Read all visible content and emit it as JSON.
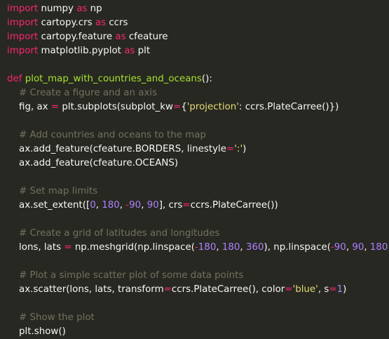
{
  "colors": {
    "background": "#272822",
    "keyword": "#f92672",
    "function_name": "#a6e22e",
    "string": "#e6db74",
    "number": "#ae81ff",
    "comment": "#75715e",
    "text": "#f8f8f2"
  },
  "lines": [
    {
      "tokens": [
        {
          "t": "import",
          "c": "kw"
        },
        {
          "t": " numpy ",
          "c": "tx"
        },
        {
          "t": "as",
          "c": "kw"
        },
        {
          "t": " np",
          "c": "tx"
        }
      ]
    },
    {
      "tokens": [
        {
          "t": "import",
          "c": "kw"
        },
        {
          "t": " cartopy.crs ",
          "c": "tx"
        },
        {
          "t": "as",
          "c": "kw"
        },
        {
          "t": " ccrs",
          "c": "tx"
        }
      ]
    },
    {
      "tokens": [
        {
          "t": "import",
          "c": "kw"
        },
        {
          "t": " cartopy.feature ",
          "c": "tx"
        },
        {
          "t": "as",
          "c": "kw"
        },
        {
          "t": " cfeature",
          "c": "tx"
        }
      ]
    },
    {
      "tokens": [
        {
          "t": "import",
          "c": "kw"
        },
        {
          "t": " matplotlib.pyplot ",
          "c": "tx"
        },
        {
          "t": "as",
          "c": "kw"
        },
        {
          "t": " plt",
          "c": "tx"
        }
      ]
    },
    {
      "tokens": []
    },
    {
      "tokens": [
        {
          "t": "def",
          "c": "kw"
        },
        {
          "t": " ",
          "c": "tx"
        },
        {
          "t": "plot_map_with_countries_and_oceans",
          "c": "fn"
        },
        {
          "t": "():",
          "c": "tx"
        }
      ]
    },
    {
      "tokens": [
        {
          "t": "    # Create a figure and an axis",
          "c": "cm"
        }
      ]
    },
    {
      "tokens": [
        {
          "t": "    fig, ax ",
          "c": "tx"
        },
        {
          "t": "=",
          "c": "kw"
        },
        {
          "t": " plt.subplots(subplot_kw",
          "c": "tx"
        },
        {
          "t": "=",
          "c": "kw"
        },
        {
          "t": "{",
          "c": "tx"
        },
        {
          "t": "'projection'",
          "c": "str"
        },
        {
          "t": ": ccrs.PlateCarree()})",
          "c": "tx"
        }
      ]
    },
    {
      "tokens": []
    },
    {
      "tokens": [
        {
          "t": "    # Add countries and oceans to the map",
          "c": "cm"
        }
      ]
    },
    {
      "tokens": [
        {
          "t": "    ax.add_feature(cfeature.BORDERS, linestyle",
          "c": "tx"
        },
        {
          "t": "=",
          "c": "kw"
        },
        {
          "t": "':'",
          "c": "str"
        },
        {
          "t": ")",
          "c": "tx"
        }
      ]
    },
    {
      "tokens": [
        {
          "t": "    ax.add_feature(cfeature.OCEANS)",
          "c": "tx"
        }
      ]
    },
    {
      "tokens": []
    },
    {
      "tokens": [
        {
          "t": "    # Set map limits",
          "c": "cm"
        }
      ]
    },
    {
      "tokens": [
        {
          "t": "    ax.set_extent([",
          "c": "tx"
        },
        {
          "t": "0",
          "c": "num"
        },
        {
          "t": ", ",
          "c": "tx"
        },
        {
          "t": "180",
          "c": "num"
        },
        {
          "t": ", ",
          "c": "tx"
        },
        {
          "t": "-",
          "c": "kw"
        },
        {
          "t": "90",
          "c": "num"
        },
        {
          "t": ", ",
          "c": "tx"
        },
        {
          "t": "90",
          "c": "num"
        },
        {
          "t": "], crs",
          "c": "tx"
        },
        {
          "t": "=",
          "c": "kw"
        },
        {
          "t": "ccrs.PlateCarree())",
          "c": "tx"
        }
      ]
    },
    {
      "tokens": []
    },
    {
      "tokens": [
        {
          "t": "    # Create a grid of latitudes and longitudes",
          "c": "cm"
        }
      ]
    },
    {
      "tokens": [
        {
          "t": "    lons, lats ",
          "c": "tx"
        },
        {
          "t": "=",
          "c": "kw"
        },
        {
          "t": " np.meshgrid(np.linspace(",
          "c": "tx"
        },
        {
          "t": "-",
          "c": "kw"
        },
        {
          "t": "180",
          "c": "num"
        },
        {
          "t": ", ",
          "c": "tx"
        },
        {
          "t": "180",
          "c": "num"
        },
        {
          "t": ", ",
          "c": "tx"
        },
        {
          "t": "360",
          "c": "num"
        },
        {
          "t": "), np.linspace(",
          "c": "tx"
        },
        {
          "t": "-",
          "c": "kw"
        },
        {
          "t": "90",
          "c": "num"
        },
        {
          "t": ", ",
          "c": "tx"
        },
        {
          "t": "90",
          "c": "num"
        },
        {
          "t": ", ",
          "c": "tx"
        },
        {
          "t": "180",
          "c": "num"
        },
        {
          "t": "))",
          "c": "tx"
        }
      ]
    },
    {
      "tokens": []
    },
    {
      "tokens": [
        {
          "t": "    # Plot a simple scatter plot of some data points",
          "c": "cm"
        }
      ]
    },
    {
      "tokens": [
        {
          "t": "    ax.scatter(lons, lats, transform",
          "c": "tx"
        },
        {
          "t": "=",
          "c": "kw"
        },
        {
          "t": "ccrs.PlateCarree(), color",
          "c": "tx"
        },
        {
          "t": "=",
          "c": "kw"
        },
        {
          "t": "'blue'",
          "c": "str"
        },
        {
          "t": ", s",
          "c": "tx"
        },
        {
          "t": "=",
          "c": "kw"
        },
        {
          "t": "1",
          "c": "num"
        },
        {
          "t": ")",
          "c": "tx"
        }
      ]
    },
    {
      "tokens": []
    },
    {
      "tokens": [
        {
          "t": "    # Show the plot",
          "c": "cm"
        }
      ]
    },
    {
      "tokens": [
        {
          "t": "    plt.show()",
          "c": "tx"
        }
      ]
    }
  ]
}
